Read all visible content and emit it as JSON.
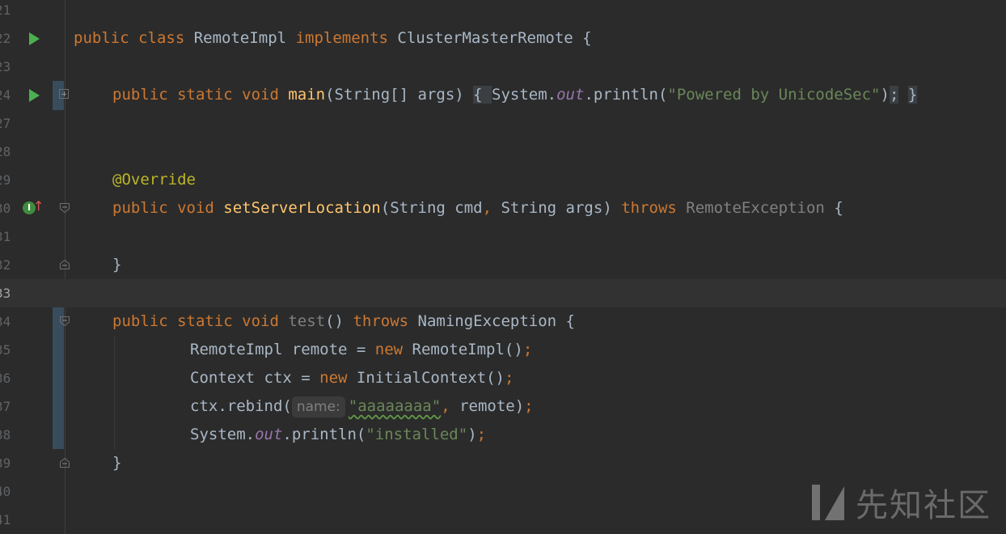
{
  "editor": {
    "lines": [
      {
        "num": "21",
        "tokens": []
      },
      {
        "num": "22",
        "icon": "run",
        "tokens": [
          {
            "c": "kw",
            "t": "public class "
          },
          {
            "c": "plain",
            "t": "RemoteImpl "
          },
          {
            "c": "kw",
            "t": "implements "
          },
          {
            "c": "plain",
            "t": "ClusterMasterRemote {"
          }
        ]
      },
      {
        "num": "23",
        "tokens": []
      },
      {
        "num": "24",
        "icon": "run",
        "fold": "plus",
        "tokens": [
          {
            "c": "kw",
            "t": "public static void "
          },
          {
            "c": "fn",
            "t": "main"
          },
          {
            "c": "plain",
            "t": "(String[] args) "
          },
          {
            "c": "brace-hl",
            "t": "{ "
          },
          {
            "c": "plain",
            "t": "System."
          },
          {
            "c": "static",
            "t": "out"
          },
          {
            "c": "plain",
            "t": ".println("
          },
          {
            "c": "str",
            "t": "\"Powered by UnicodeSec\""
          },
          {
            "c": "plain",
            "t": ")"
          },
          {
            "c": "brace-hl",
            "t": ";"
          },
          {
            "c": "plain",
            "t": " "
          },
          {
            "c": "brace-hl",
            "t": "}"
          }
        ]
      },
      {
        "num": "27",
        "tokens": []
      },
      {
        "num": "28",
        "tokens": []
      },
      {
        "num": "29",
        "tokens": [
          {
            "c": "ann",
            "t": "@Override"
          }
        ]
      },
      {
        "num": "30",
        "icon": "impl",
        "fold": "start",
        "tokens": [
          {
            "c": "kw",
            "t": "public void "
          },
          {
            "c": "fn",
            "t": "setServerLocation"
          },
          {
            "c": "plain",
            "t": "(String cmd"
          },
          {
            "c": "kw",
            "t": ", "
          },
          {
            "c": "plain",
            "t": "String args) "
          },
          {
            "c": "kw",
            "t": "throws "
          },
          {
            "c": "unused",
            "t": "RemoteException "
          },
          {
            "c": "plain",
            "t": "{"
          }
        ]
      },
      {
        "num": "31",
        "tokens": []
      },
      {
        "num": "32",
        "fold": "end",
        "tokens": [
          {
            "c": "plain",
            "t": "}"
          }
        ]
      },
      {
        "num": "33",
        "current": true,
        "tokens": []
      },
      {
        "num": "34",
        "fold": "start",
        "tokens": [
          {
            "c": "kw",
            "t": "public static void "
          },
          {
            "c": "unused",
            "t": "test"
          },
          {
            "c": "plain",
            "t": "() "
          },
          {
            "c": "kw",
            "t": "throws "
          },
          {
            "c": "plain",
            "t": "NamingException {"
          }
        ]
      },
      {
        "num": "35",
        "deep": true,
        "tokens": [
          {
            "c": "plain",
            "t": "RemoteImpl remote = "
          },
          {
            "c": "kw",
            "t": "new "
          },
          {
            "c": "plain",
            "t": "RemoteImpl()"
          },
          {
            "c": "kw",
            "t": ";"
          }
        ]
      },
      {
        "num": "36",
        "deep": true,
        "tokens": [
          {
            "c": "plain",
            "t": "Context ctx = "
          },
          {
            "c": "kw",
            "t": "new "
          },
          {
            "c": "plain",
            "t": "InitialContext()"
          },
          {
            "c": "kw",
            "t": ";"
          }
        ]
      },
      {
        "num": "37",
        "deep": true,
        "tokens": [
          {
            "c": "plain",
            "t": "ctx.rebind("
          },
          {
            "c": "hint",
            "t": "name:"
          },
          {
            "c": "str typo",
            "t": "\"aaaaaaaa\""
          },
          {
            "c": "kw",
            "t": ", "
          },
          {
            "c": "plain",
            "t": "remote)"
          },
          {
            "c": "kw",
            "t": ";"
          }
        ]
      },
      {
        "num": "38",
        "deep": true,
        "tokens": [
          {
            "c": "plain",
            "t": "System."
          },
          {
            "c": "static",
            "t": "out"
          },
          {
            "c": "plain",
            "t": ".println("
          },
          {
            "c": "str",
            "t": "\"installed\""
          },
          {
            "c": "plain",
            "t": ")"
          },
          {
            "c": "kw",
            "t": ";"
          }
        ]
      },
      {
        "num": "39",
        "fold": "end",
        "tokens": [
          {
            "c": "plain",
            "t": "}"
          }
        ]
      },
      {
        "num": "40",
        "tokens": []
      },
      {
        "num": "41",
        "tokens": []
      }
    ],
    "indent_levels": {
      "0": [
        21,
        22,
        23
      ],
      "1": [
        24,
        27,
        28,
        29,
        30,
        31,
        32,
        33,
        34,
        39,
        40,
        41
      ],
      "2": [
        35,
        36,
        37,
        38
      ]
    }
  },
  "watermark": {
    "text": "先知社区",
    "icon": "xianzhi-logo-icon"
  },
  "colors": {
    "background": "#2b2b2b",
    "keyword": "#cc7832",
    "function": "#ffc66d",
    "string": "#6a8759",
    "static_field": "#9876aa",
    "annotation": "#bbb529",
    "run_icon": "#4caf50"
  }
}
